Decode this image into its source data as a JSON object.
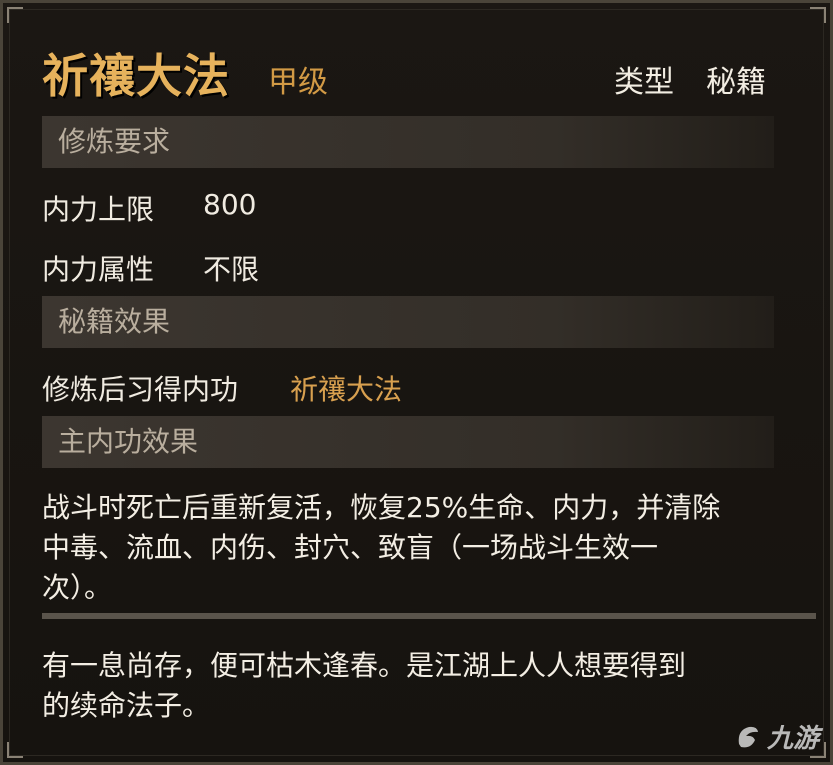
{
  "header": {
    "title": "祈禳大法",
    "grade": "甲级",
    "type_label": "类型",
    "type_value": "秘籍"
  },
  "sections": {
    "requirements_title": "修炼要求",
    "effect_title": "秘籍效果",
    "main_effect_title": "主内功效果"
  },
  "requirements": {
    "max_internal_label": "内力上限",
    "max_internal_value": "800",
    "attribute_label": "内力属性",
    "attribute_value": "不限"
  },
  "effect": {
    "learn_label": "修炼后习得内功",
    "learn_value": "祈禳大法"
  },
  "main_effect": {
    "line1": "战斗时死亡后重新复活，恢复25%生命、内力，并清除",
    "line2": "中毒、流血、内伤、封穴、致盲（一场战斗生效一",
    "line3": "次）。"
  },
  "flavor": {
    "line1": "有一息尚存，便可枯木逢春。是江湖上人人想要得到",
    "line2": "的续命法子。"
  },
  "watermark": {
    "text": "九游"
  },
  "colors": {
    "title": "#e6b25c",
    "grade": "#d29a45",
    "highlight": "#d8a04f",
    "text": "#f0ebe1",
    "section_text": "#b9ae9e",
    "section_bg": "#3c3630"
  }
}
